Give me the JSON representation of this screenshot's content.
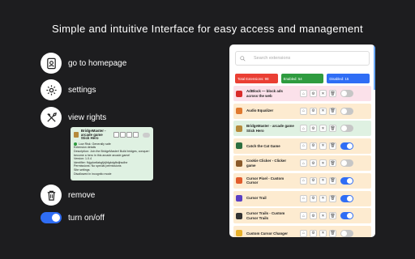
{
  "headline": "Simple and intuitive Interface for easy access and management",
  "features": {
    "homepage": "go to homepage",
    "settings": "settings",
    "rights": "view rights",
    "remove": "remove",
    "toggle": "turn on/off"
  },
  "detail_card": {
    "title": "BridgeMaster - arcade game Stick Hero",
    "status": "Low Risk: Generally safe",
    "lines": [
      "Extension details",
      "Description: Join the BridgeMaster! Build bridges, conquer levels, and",
      "become a hero in this arcade arcade game!",
      "Version: 1.0.4",
      "Identifier: fhjgdoeilabgfjdjhfgbdgfbdjhsdhe",
      "Permissions: No special permissions",
      "Site settings",
      "Disallowed in incognito mode"
    ]
  },
  "panel": {
    "search_placeholder": "Search extensions",
    "stats": {
      "total": "Total Extensions: 98",
      "enabled": "Enabled: 54",
      "disabled": "Disabled: 15"
    },
    "extensions": [
      {
        "name": "AdBlock — block ads across the web",
        "icon_color": "#d92b2b",
        "enabled": false,
        "row": "pink"
      },
      {
        "name": "Audio Equalizer",
        "icon_color": "#e0792f",
        "enabled": false,
        "row": "enabled"
      },
      {
        "name": "BridgeMaster - arcade game Stick Hero",
        "icon_color": "#b58a3c",
        "enabled": false,
        "row": "green"
      },
      {
        "name": "Catch the Cat Game",
        "icon_color": "#2c6e3f",
        "enabled": true,
        "row": "enabled"
      },
      {
        "name": "Cookie Clicker - Clicker game",
        "icon_color": "#8a5a2b",
        "enabled": false,
        "row": "enabled"
      },
      {
        "name": "Cursor Pixel - Custom Cursor",
        "icon_color": "#e25c2c",
        "enabled": true,
        "row": "enabled"
      },
      {
        "name": "Cursor Trail",
        "icon_color": "#5a3fc4",
        "enabled": true,
        "row": "enabled"
      },
      {
        "name": "Cursor Trails - Custom Cursor Trails",
        "icon_color": "#333333",
        "enabled": true,
        "row": "enabled"
      },
      {
        "name": "Custom Cursor Changer",
        "icon_color": "#e8b12b",
        "enabled": false,
        "row": "enabled"
      }
    ]
  }
}
